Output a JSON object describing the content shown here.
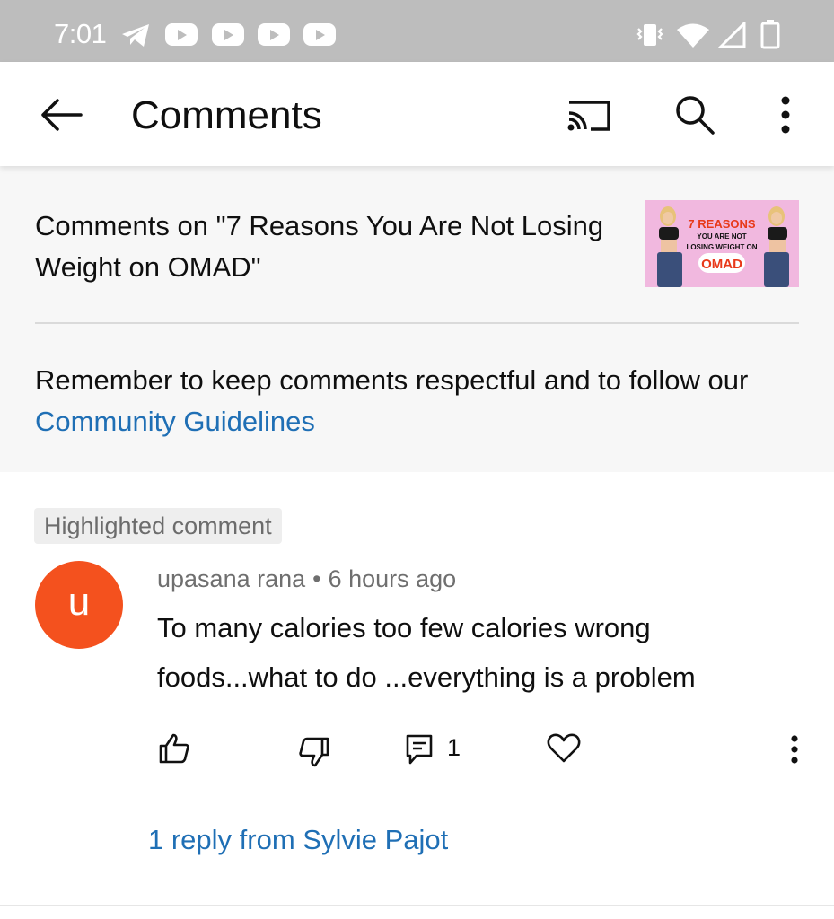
{
  "status_bar": {
    "time": "7:01",
    "left_icons": [
      "telegram-icon",
      "youtube-notification-icon",
      "youtube-notification-icon",
      "youtube-notification-icon",
      "youtube-notification-icon"
    ],
    "right_icons": [
      "vibrate-icon",
      "wifi-icon",
      "cell-signal-icon",
      "battery-icon"
    ]
  },
  "app_bar": {
    "title": "Comments",
    "icons": [
      "back-arrow-icon",
      "cast-icon",
      "search-icon",
      "more-vert-icon"
    ]
  },
  "header": {
    "video_title": "Comments on \"7 Reasons You Are Not Losing Weight on OMAD\"",
    "thumbnail": {
      "line1": "7 REASONS",
      "line2": "YOU ARE NOT",
      "line3": "LOSING WEIGHT ON",
      "line4": "OMAD"
    },
    "guideline_text": "Remember to keep comments respectful and to follow our",
    "guideline_link": "Community Guidelines"
  },
  "comment": {
    "badge": "Highlighted comment",
    "avatar_letter": "u",
    "author": "upasana rana",
    "separator": "•",
    "time": "6 hours ago",
    "text": "To many calories too few calories wrong foods...what to do ...everything is a problem",
    "reply_count": "1",
    "replies_link": "1 reply from Sylvie Pajot",
    "action_icons": [
      "thumbs-up-icon",
      "thumbs-down-icon",
      "reply-icon",
      "heart-icon",
      "more-vert-icon"
    ]
  },
  "colors": {
    "status_bar_bg": "#bdbdbd",
    "link": "#1f6fb5",
    "avatar_bg": "#f4511e",
    "header_panel_bg": "#f7f7f7"
  }
}
